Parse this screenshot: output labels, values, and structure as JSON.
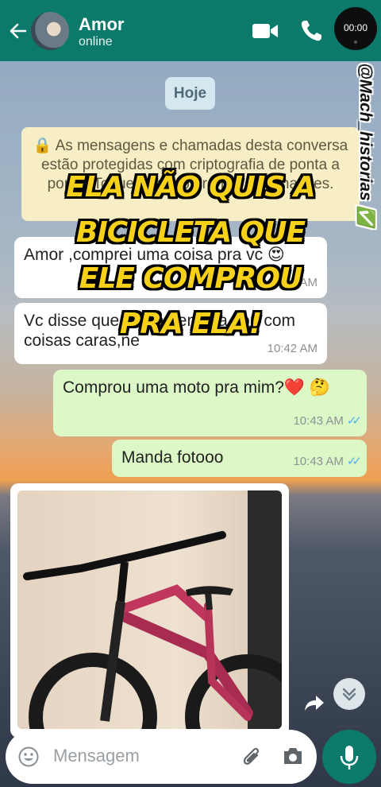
{
  "header": {
    "contact_name": "Amor",
    "status": "online",
    "timer": "00:00"
  },
  "chat": {
    "date_pill": "Hoje",
    "notice": "🔒 As mensagens e chamadas desta conversa estão protegidas com criptografia de ponta a ponta. Toque para obter mais informações.",
    "messages": [
      {
        "text": "Amor ,comprei uma coisa pra vc 😍",
        "time": "10:42 AM"
      },
      {
        "text": "Vc disse que se contentava sou com coisas caras,ne",
        "time": "10:42 AM"
      },
      {
        "text": "Comprou uma moto pra mim?❤️ 🤔",
        "time": "10:43 AM"
      },
      {
        "text": "Manda fotooo",
        "time": "10:43 AM"
      }
    ]
  },
  "overlay": {
    "line1": "ELA NÃO QUIS A",
    "line2": "BICICLETA QUE",
    "line3": "ELE COMPROU",
    "line4": "PRA ELA!"
  },
  "watermark": "@Mach_historias ✅",
  "composer": {
    "placeholder": "Mensagem"
  },
  "colors": {
    "header": "#0b7a6b",
    "incoming": "#ffffff",
    "outgoing": "#dcf8c6",
    "overlay_text": "#f6d117"
  }
}
